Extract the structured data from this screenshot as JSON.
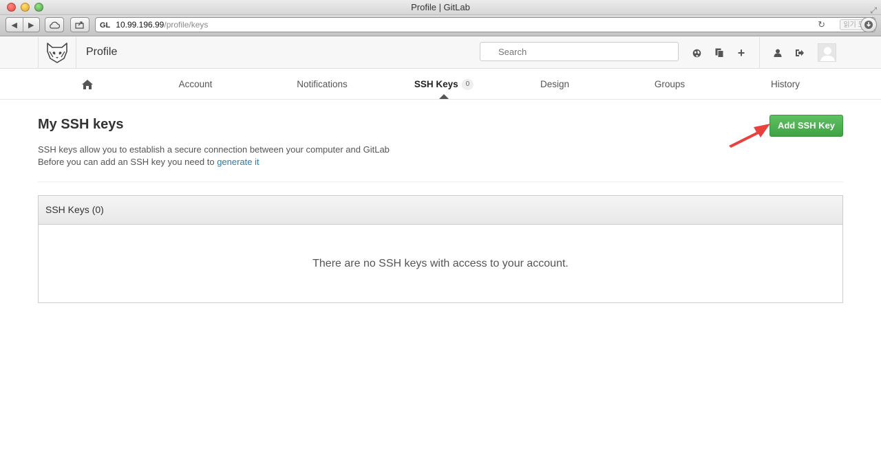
{
  "window": {
    "title": "Profile | GitLab"
  },
  "browser": {
    "favicon_text": "GL",
    "url_host": "10.99.196.99",
    "url_path": "/profile/keys",
    "reader_label": "읽기 도구",
    "back_glyph": "◀",
    "forward_glyph": "▶",
    "reload_glyph": "↻"
  },
  "header": {
    "app_title": "Profile",
    "search_placeholder": "Search",
    "icons": [
      "globe-icon",
      "copy-icon",
      "plus-icon",
      "user-icon",
      "sign-out-icon"
    ],
    "plus_glyph": "+"
  },
  "nav": {
    "items": [
      {
        "label": "",
        "icon": "home-icon"
      },
      {
        "label": "Account"
      },
      {
        "label": "Notifications"
      },
      {
        "label": "SSH Keys",
        "badge": "0",
        "active": true
      },
      {
        "label": "Design"
      },
      {
        "label": "Groups"
      },
      {
        "label": "History"
      }
    ]
  },
  "content": {
    "title": "My SSH keys",
    "add_button": "Add SSH Key",
    "desc_line1": "SSH keys allow you to establish a secure connection between your computer and GitLab",
    "desc_line2_prefix": "Before you can add an SSH key you need to",
    "desc_line2_link": "generate it",
    "panel_title": "SSH Keys (0)",
    "empty_message": "There are no SSH keys with access to your account."
  },
  "colors": {
    "accent_green": "#47b04b",
    "link_blue": "#2a7aa8",
    "annotation_arrow": "#e8413e"
  }
}
